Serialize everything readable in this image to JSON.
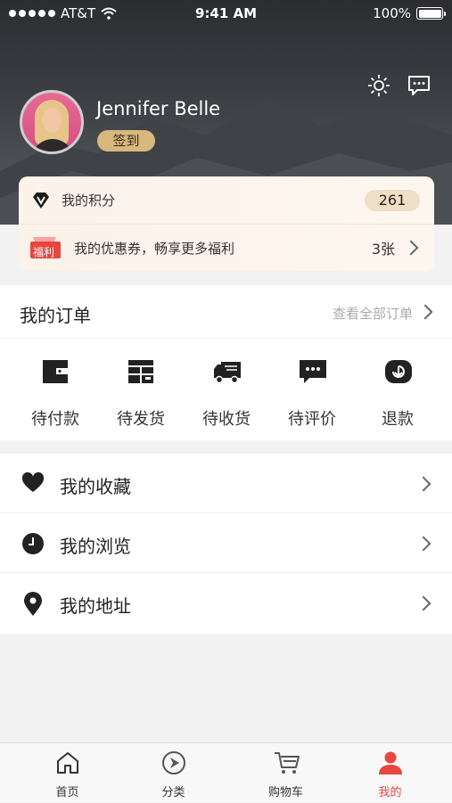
{
  "status_bar": {
    "carrier": "AT&T",
    "time": "9:41 AM",
    "battery": "100%"
  },
  "profile": {
    "name": "Jennifer Belle",
    "signin_label": "签到"
  },
  "points": {
    "label": "我的积分",
    "value": "261"
  },
  "coupon": {
    "badge": "福利",
    "label": "我的优惠券，畅享更多福利",
    "count": "3张"
  },
  "orders": {
    "title": "我的订单",
    "view_all": "查看全部订单",
    "items": [
      {
        "label": "待付款",
        "icon": "wallet-icon"
      },
      {
        "label": "待发货",
        "icon": "package-icon"
      },
      {
        "label": "待收货",
        "icon": "truck-icon"
      },
      {
        "label": "待评价",
        "icon": "comment-icon"
      },
      {
        "label": "退款",
        "icon": "refund-icon"
      }
    ]
  },
  "menu": [
    {
      "label": "我的收藏",
      "icon": "heart-icon"
    },
    {
      "label": "我的浏览",
      "icon": "clock-icon"
    },
    {
      "label": "我的地址",
      "icon": "location-pin-icon"
    }
  ],
  "tabs": [
    {
      "label": "首页",
      "icon": "home-icon"
    },
    {
      "label": "分类",
      "icon": "compass-icon"
    },
    {
      "label": "购物车",
      "icon": "cart-icon"
    },
    {
      "label": "我的",
      "icon": "user-icon",
      "active": true
    }
  ],
  "colors": {
    "accent": "#e8473f",
    "gold": "#d7b77c",
    "header_dark": "#2b2d31"
  }
}
